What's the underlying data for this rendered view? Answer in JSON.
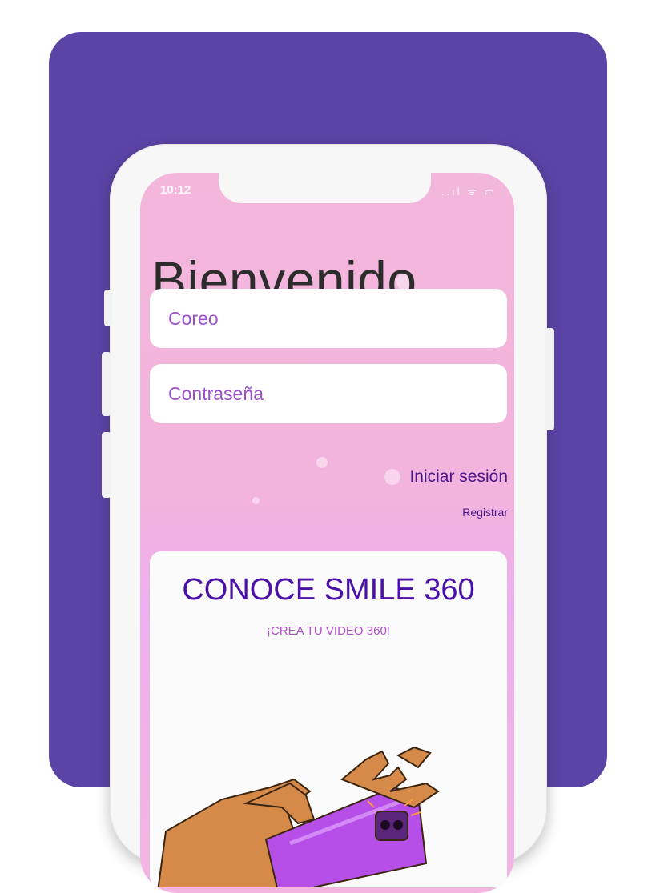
{
  "status_bar": {
    "time": "10:12",
    "icons": "..ıl ᯤ ▭"
  },
  "welcome": {
    "title": "Bienvenido"
  },
  "form": {
    "email_placeholder": "Coreo",
    "password_placeholder": "Contraseña",
    "login_label": "Iniciar sesión",
    "register_label": "Registrar"
  },
  "promo": {
    "title": "CONOCE SMILE 360",
    "subtitle": "¡CREA TU VIDEO 360!",
    "illustration": "hands-holding-phone"
  },
  "colors": {
    "frame_bg": "#5c44a6",
    "screen_pink": "#f4b7dc",
    "accent_purple": "#4a10a8",
    "field_text": "#9a51c9"
  }
}
